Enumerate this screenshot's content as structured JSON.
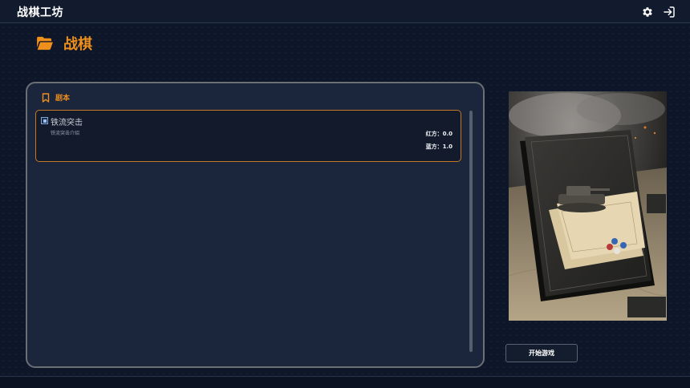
{
  "app": {
    "title": "战棋工坊"
  },
  "header": {
    "icons": [
      "gear-icon",
      "logout-icon"
    ]
  },
  "page": {
    "title": "战棋",
    "icon": "folder-open-icon"
  },
  "scripts_panel": {
    "label": "剧本",
    "icon": "bookmark-icon",
    "items": [
      {
        "name": "铁流突击",
        "description": "铁流突击介绍",
        "red_label": "红方：",
        "red_value": "0.0",
        "blue_label": "蓝方：",
        "blue_value": "1.0",
        "selected": true
      }
    ]
  },
  "actions": {
    "start_label": "开始游戏"
  },
  "colors": {
    "accent": "#ef8f1c",
    "background": "#0e1729",
    "panel": "#1b263d",
    "selected_border": "#c47a24"
  }
}
